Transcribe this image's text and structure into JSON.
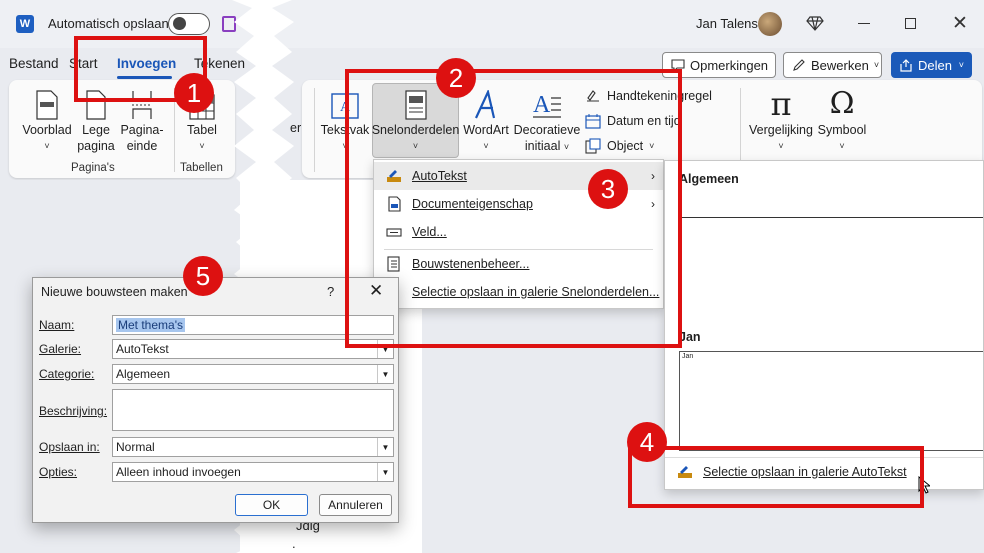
{
  "titlebar": {
    "autosave_label": "Automatisch opslaan",
    "user_name": "Jan Talens"
  },
  "tabs": [
    "Bestand",
    "Start",
    "Invoegen",
    "Tekenen"
  ],
  "top_buttons": {
    "comments": "Opmerkingen",
    "edit": "Bewerken",
    "share": "Delen"
  },
  "ribbon": {
    "cover_page": "Voorblad",
    "blank_page_1": "Lege",
    "blank_page_2": "pagina",
    "page_break_1": "Pagina-",
    "page_break_2": "einde",
    "pages_group": "Pagina's",
    "table": "Tabel",
    "tables_group": "Tabellen",
    "textbox": "Tekstvak",
    "quickparts": "Snelonderdelen",
    "wordart": "WordArt",
    "dropcap_1": "Decoratieve",
    "dropcap_2": "initiaal",
    "signature_line": "Handtekeningregel",
    "date_time": "Datum en tijd",
    "object": "Object",
    "equation": "Vergelijking",
    "symbol": "Symbool",
    "partial": "er"
  },
  "menu": {
    "autotext": "AutoTekst",
    "docproperty": "Documenteigenschap",
    "field": "Veld...",
    "organizer": "Bouwstenenbeheer...",
    "save_selection": "Selectie opslaan in galerie Snelonderdelen..."
  },
  "gallery": {
    "header_general": "Algemeen",
    "header_jan": "Jan",
    "preview_text": "Jan",
    "save_label": "Selectie opslaan in galerie AutoTekst"
  },
  "dialog": {
    "title": "Nieuwe bouwsteen maken",
    "help": "?",
    "name_label": "Naam:",
    "name_value": "Met thema's",
    "gallery_label": "Galerie:",
    "gallery_value": "AutoTekst",
    "category_label": "Categorie:",
    "category_value": "Algemeen",
    "description_label": "Beschrijving:",
    "save_in_label": "Opslaan in:",
    "save_in_value": "Normal",
    "options_label": "Opties:",
    "options_value": "Alleen inhoud invoegen",
    "ok": "OK",
    "cancel": "Annuleren"
  },
  "doc": {
    "line1": "Jdig",
    "line2": "."
  },
  "markers": [
    "1",
    "2",
    "3",
    "4",
    "5"
  ],
  "colors": {
    "accent": "#1a56b8",
    "marker": "#dd1111",
    "share_bg": "#1b5ab9"
  }
}
